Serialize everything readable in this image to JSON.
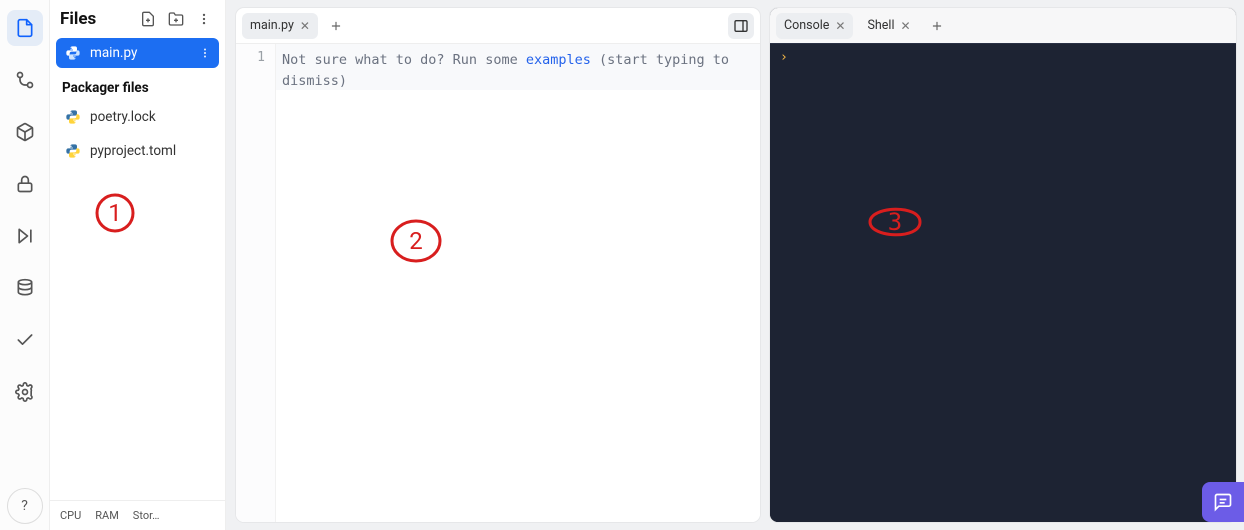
{
  "rail": {
    "items": [
      {
        "name": "files-icon",
        "active": true
      },
      {
        "name": "git-icon",
        "active": false
      },
      {
        "name": "packages-icon",
        "active": false
      },
      {
        "name": "lock-icon",
        "active": false
      },
      {
        "name": "run-icon",
        "active": false
      },
      {
        "name": "database-icon",
        "active": false
      },
      {
        "name": "check-icon",
        "active": false
      },
      {
        "name": "settings-icon",
        "active": false
      }
    ],
    "help_label": "?"
  },
  "sidebar": {
    "title": "Files",
    "files": [
      {
        "name": "main.py",
        "active": true
      }
    ],
    "section": "Packager files",
    "packager_files": [
      {
        "name": "poetry.lock",
        "active": false
      },
      {
        "name": "pyproject.toml",
        "active": false
      }
    ],
    "footer": [
      "CPU",
      "RAM",
      "Stor…"
    ]
  },
  "editor": {
    "tabs": [
      {
        "label": "main.py",
        "active": true
      }
    ],
    "line_numbers": [
      "1"
    ],
    "hint_prefix": "Not sure what to do? Run some ",
    "hint_link": "examples",
    "hint_suffix": " (start typing to dismiss)"
  },
  "console": {
    "tabs": [
      {
        "label": "Console",
        "active": true
      },
      {
        "label": "Shell",
        "active": false
      }
    ],
    "prompt": ""
  },
  "annotations": [
    {
      "id": "mark-1",
      "label": "1"
    },
    {
      "id": "mark-2",
      "label": "2"
    },
    {
      "id": "mark-3",
      "label": "3"
    }
  ]
}
